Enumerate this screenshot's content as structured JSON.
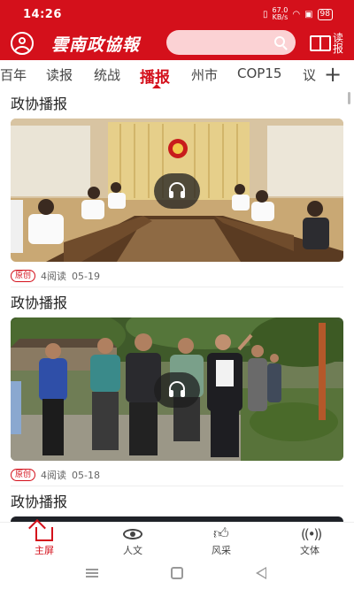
{
  "status_bar": {
    "time": "14:26",
    "net_speed_value": "67.0",
    "net_speed_unit": "KB/s",
    "battery": "98"
  },
  "header": {
    "logo_text": "雲南政協報",
    "search_placeholder": "",
    "read_label": "读报"
  },
  "tabs": [
    "百年",
    "读报",
    "统战",
    "播报",
    "州市",
    "COP15",
    "议"
  ],
  "active_tab": "播报",
  "feed": [
    {
      "title": "政协播报",
      "badge": "原创",
      "reads": "4阅读",
      "date": "05-19"
    },
    {
      "title": "政协播报",
      "badge": "原创",
      "reads": "4阅读",
      "date": "05-18"
    },
    {
      "title": "政协播报"
    }
  ],
  "bottom_nav": [
    "主屏",
    "人文",
    "风采",
    "文体"
  ],
  "colors": {
    "brand": "#d4101b",
    "search_bg": "#fbd2d4"
  }
}
